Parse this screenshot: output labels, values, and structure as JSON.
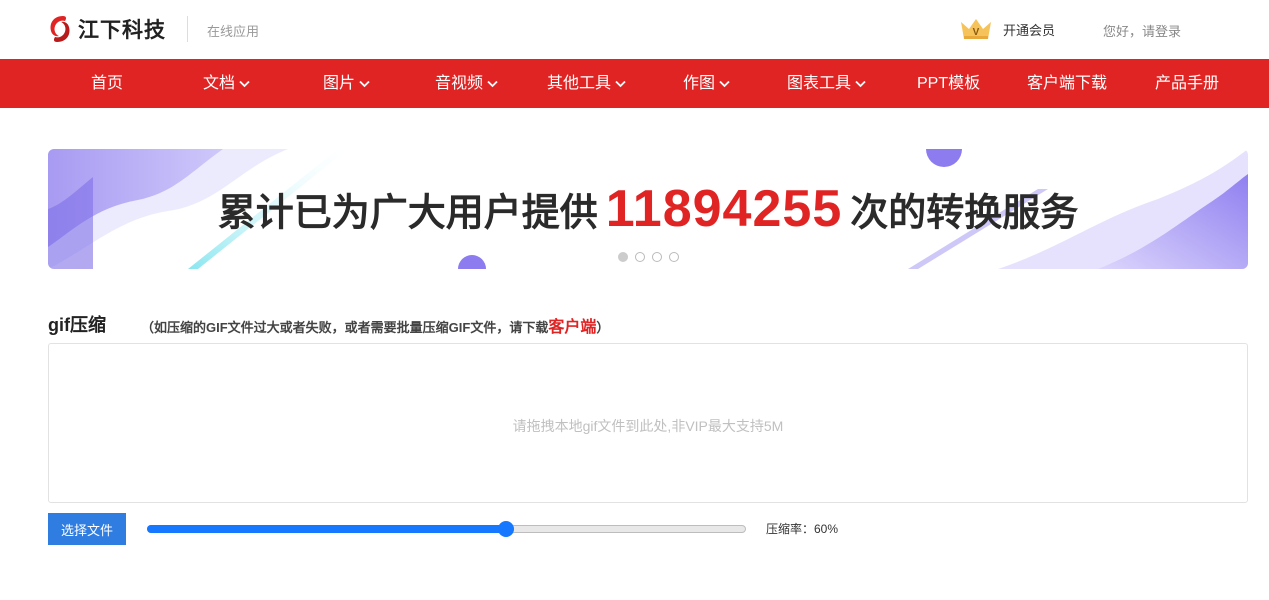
{
  "header": {
    "logo_text": "江下科技",
    "subtitle": "在线应用",
    "vip_label": "开通会员",
    "login_label": "您好，请登录"
  },
  "nav": {
    "items": [
      {
        "label": "首页",
        "dropdown": false
      },
      {
        "label": "文档",
        "dropdown": true
      },
      {
        "label": "图片",
        "dropdown": true
      },
      {
        "label": "音视频",
        "dropdown": true
      },
      {
        "label": "其他工具",
        "dropdown": true
      },
      {
        "label": "作图",
        "dropdown": true
      },
      {
        "label": "图表工具",
        "dropdown": true
      },
      {
        "label": "PPT模板",
        "dropdown": false
      },
      {
        "label": "客户端下载",
        "dropdown": false
      },
      {
        "label": "产品手册",
        "dropdown": false
      }
    ],
    "color": "#e02424"
  },
  "banner": {
    "text_before": "累计已为广大用户提供",
    "count": "11894255",
    "text_after": "次的转换服务",
    "slides": 4,
    "active_slide": 1
  },
  "tool": {
    "title": "gif压缩",
    "note_before": "（如压缩的GIF文件过大或者失败，或者需要批量压缩GIF文件，请下载",
    "note_link": "客户端",
    "note_after": "）",
    "dropzone_hint": "请拖拽本地gif文件到此处,非VIP最大支持5M",
    "choose_button": "选择文件",
    "compression_label": "压缩率：60%",
    "compression_rate": 0.6
  },
  "colors": {
    "accent_red": "#e02424",
    "accent_blue": "#1677ff"
  }
}
